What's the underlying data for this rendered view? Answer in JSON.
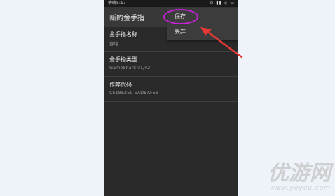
{
  "status_bar": {
    "time": "傍晚5:17",
    "icons": "⊙ ▮▮ ◇ ▭"
  },
  "appbar": {
    "title": "新的金手指"
  },
  "menu": {
    "save_label": "保存",
    "discard_label": "丢弃"
  },
  "fields": [
    {
      "label": "金手指名称",
      "value": "穿墙"
    },
    {
      "label": "金手指类型",
      "value": "GameShark v1/v2"
    },
    {
      "label": "作弊代码",
      "value": "C518E259 5ADBAF5B"
    }
  ],
  "watermark": {
    "text": "优游网",
    "url": "www.yoyou.com"
  },
  "annotation_colors": {
    "circle": "#c322d6",
    "arrow": "#e53935"
  }
}
